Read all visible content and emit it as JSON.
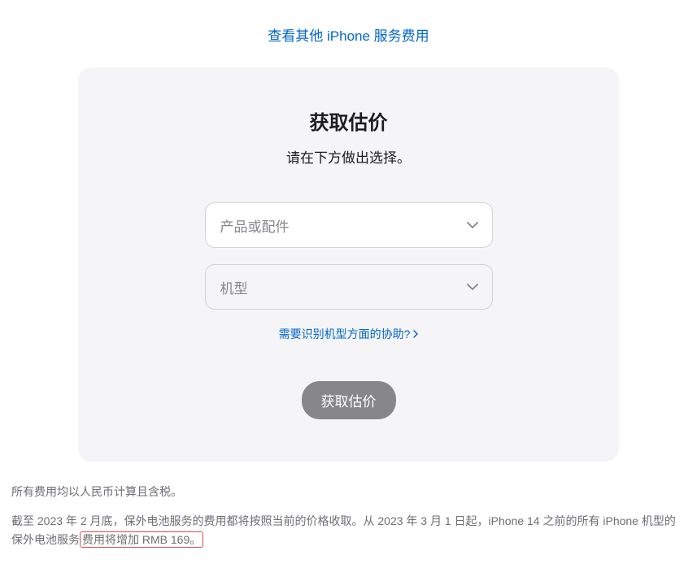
{
  "topLink": {
    "label": "查看其他 iPhone 服务费用"
  },
  "card": {
    "title": "获取估价",
    "subtitle": "请在下方做出选择。",
    "select1": {
      "placeholder": "产品或配件"
    },
    "select2": {
      "placeholder": "机型"
    },
    "helpLink": {
      "label": "需要识别机型方面的协助?"
    },
    "submit": {
      "label": "获取估价"
    }
  },
  "footer": {
    "line1": "所有费用均以人民币计算且含税。",
    "line2_part1": "截至 2023 年 2 月底，保外电池服务的费用都将按照当前的价格收取。从 2023 年 3 月 1 日起，iPhone 14 之前的所有 iPhone 机型的保外电池服务",
    "line2_highlight": "费用将增加 RMB 169。"
  }
}
